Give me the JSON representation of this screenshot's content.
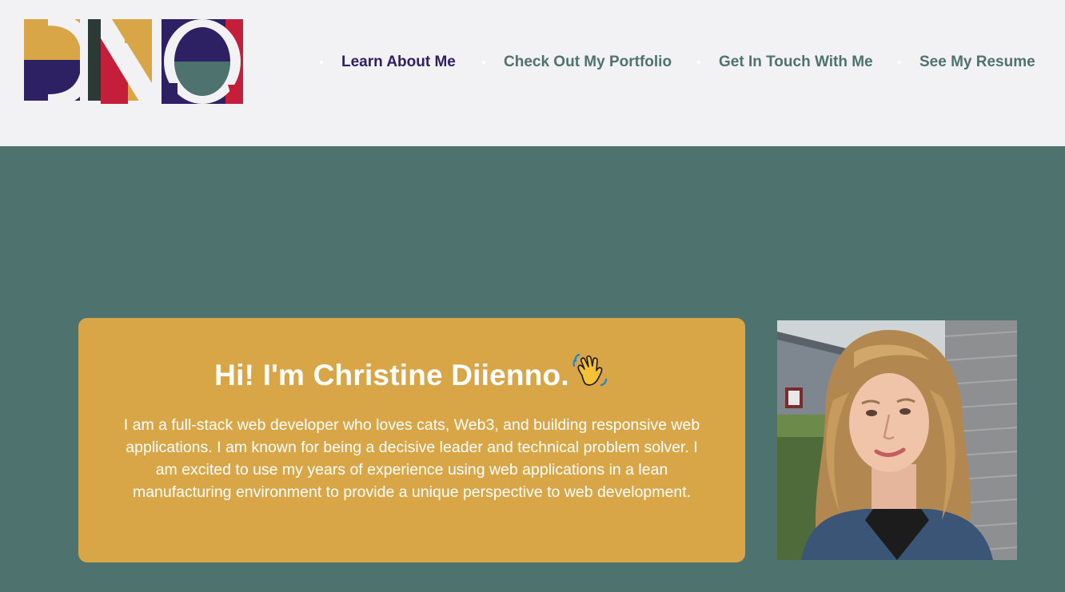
{
  "brand": {
    "logo_letters": "DNO",
    "colors": {
      "gold": "#d9a647",
      "navy": "#2d2063",
      "red": "#c41e3a",
      "teal": "#4e736e",
      "dark": "#2b3a35"
    }
  },
  "nav": {
    "items": [
      {
        "label": "Learn About Me",
        "active": true
      },
      {
        "label": "Check Out My Portfolio",
        "active": false
      },
      {
        "label": "Get In Touch With Me",
        "active": false
      },
      {
        "label": "See My Resume",
        "active": false
      }
    ]
  },
  "hero": {
    "title": "Hi! I'm Christine Diienno.",
    "title_icon": "waving-hand-icon",
    "description": "I am a full-stack web developer who loves cats, Web3, and building responsive web applications. I am known for being a decisive leader and technical problem solver. I am excited to use my years of experience using web applications in a lean manufacturing environment to provide a unique perspective to web development.",
    "photo_icon": "profile-photo"
  },
  "theme": {
    "header_bg": "#f2f2f4",
    "page_bg": "#4e736e",
    "card_bg": "#d9a647",
    "nav_active": "#2d2063",
    "nav_default": "#4e736e"
  }
}
